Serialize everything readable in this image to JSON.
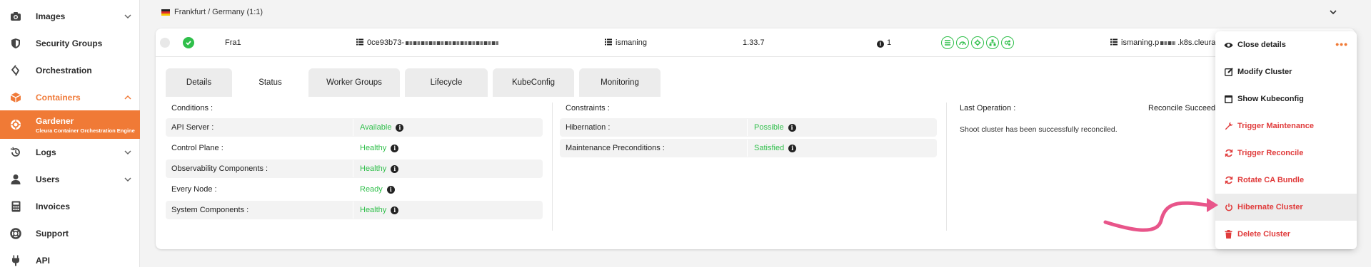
{
  "sidebar": {
    "items": [
      {
        "label": "Images",
        "icon": "camera-icon"
      },
      {
        "label": "Security Groups",
        "icon": "shield-icon"
      },
      {
        "label": "Orchestration",
        "icon": "orchestration-icon"
      },
      {
        "label": "Containers",
        "icon": "box-icon"
      },
      {
        "label": "Gardener",
        "sub": "Cleura Container Orchestration Engine",
        "icon": "gardener-icon"
      },
      {
        "label": "Logs",
        "icon": "history-icon"
      },
      {
        "label": "Users",
        "icon": "user-icon"
      },
      {
        "label": "Invoices",
        "icon": "calculator-icon"
      },
      {
        "label": "Support",
        "icon": "lifebuoy-icon"
      },
      {
        "label": "API",
        "icon": "plug-icon"
      }
    ]
  },
  "region": {
    "label": "Frankfurt / Germany (1:1)"
  },
  "cluster": {
    "name": "Fra1",
    "id_prefix": "0ce93b73-",
    "project": "ismaning",
    "version": "1.33.7",
    "workers": "1",
    "domain_prefix": "ismaning.p",
    "domain_suffix": ".k8s.cleura"
  },
  "tabs": [
    "Details",
    "Status",
    "Worker Groups",
    "Lifecycle",
    "KubeConfig",
    "Monitoring"
  ],
  "status": {
    "conditions_title": "Conditions :",
    "conditions": [
      {
        "key": "API Server :",
        "value": "Available"
      },
      {
        "key": "Control Plane :",
        "value": "Healthy"
      },
      {
        "key": "Observability Components :",
        "value": "Healthy"
      },
      {
        "key": "Every Node :",
        "value": "Ready"
      },
      {
        "key": "System Components :",
        "value": "Healthy"
      }
    ],
    "constraints_title": "Constraints :",
    "constraints": [
      {
        "key": "Hibernation :",
        "value": "Possible"
      },
      {
        "key": "Maintenance Preconditions :",
        "value": "Satisfied"
      }
    ],
    "last_operation_title": "Last Operation :",
    "last_operation_state": "Reconcile Succeeded",
    "last_operation_text": "Shoot cluster has been successfully reconciled."
  },
  "menu": {
    "more": "•••",
    "items": [
      {
        "label": "Close details",
        "icon": "eye-icon",
        "danger": false
      },
      {
        "label": "Modify Cluster",
        "icon": "edit-icon",
        "danger": false
      },
      {
        "label": "Show Kubeconfig",
        "icon": "file-icon",
        "danger": false
      },
      {
        "label": "Trigger Maintenance",
        "icon": "wrench-icon",
        "danger": true
      },
      {
        "label": "Trigger Reconcile",
        "icon": "refresh-icon",
        "danger": true
      },
      {
        "label": "Rotate CA Bundle",
        "icon": "rotate-icon",
        "danger": true
      },
      {
        "label": "Hibernate Cluster",
        "icon": "power-icon",
        "danger": true
      },
      {
        "label": "Delete Cluster",
        "icon": "trash-icon",
        "danger": true
      }
    ]
  },
  "colors": {
    "accent": "#f07a36",
    "success": "#2fbf4a",
    "danger": "#e03b3b",
    "arrow": "#e8558a"
  }
}
